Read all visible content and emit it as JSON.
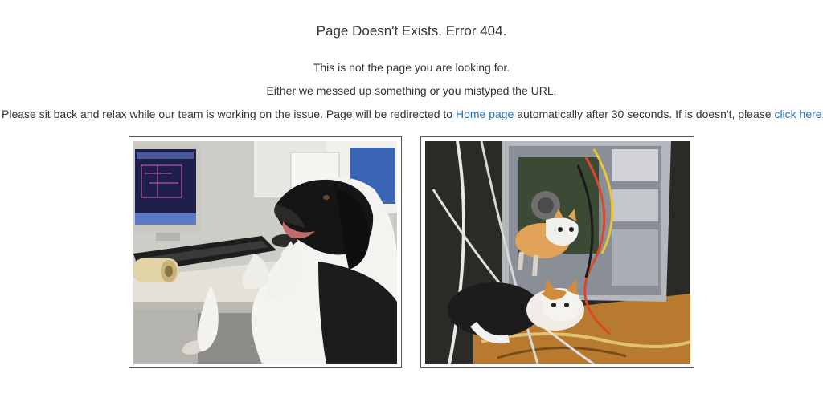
{
  "title": "Page Doesn't Exists. Error 404.",
  "message": {
    "line1": "This is not the page you are looking for.",
    "line2": "Either we messed up something or you mistyped the URL.",
    "line3_prefix": "Please sit back and relax while our team is working on the issue. Page will be redirected to ",
    "home_link": "Home page",
    "line3_middle": " automatically after 30 seconds. If is doesn't, please ",
    "click_link": "click here",
    "line3_suffix": "."
  },
  "colors": {
    "text": "#333333",
    "link": "#2a6fb6",
    "frame_border": "#555555"
  },
  "images": [
    {
      "subject": "dog-at-computer-photo"
    },
    {
      "subject": "kittens-in-computer-case-photo"
    }
  ]
}
